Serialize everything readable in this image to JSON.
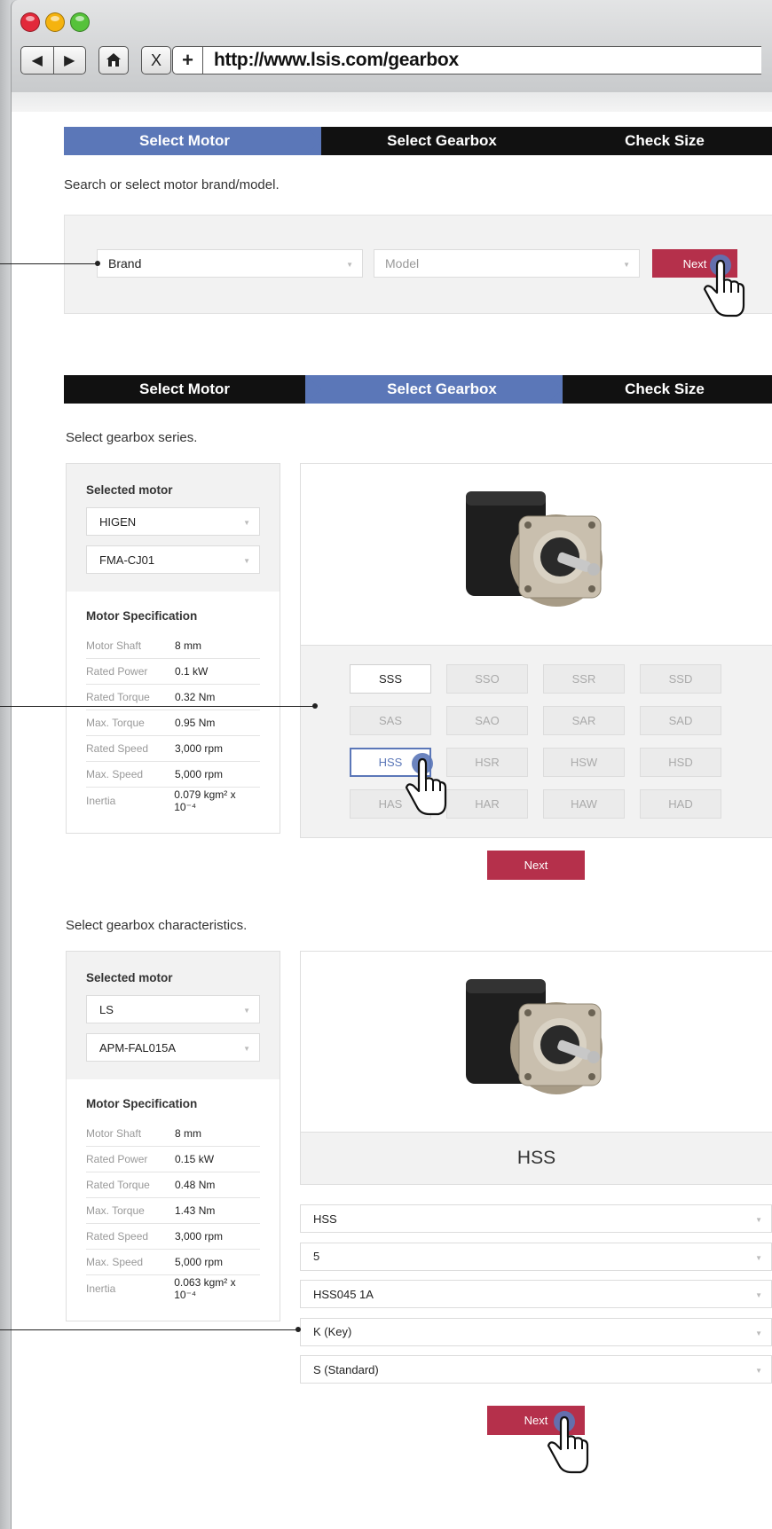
{
  "browser": {
    "url": "http://www.lsis.com/gearbox",
    "back_icon": "◀",
    "forward_icon": "▶",
    "close_label": "X",
    "new_tab_label": "+"
  },
  "steps": [
    "Select Motor",
    "Select Gearbox",
    "Check Size"
  ],
  "section1": {
    "hint": "Search or select motor brand/model.",
    "brand": "Brand",
    "model": "Model",
    "next": "Next"
  },
  "section2": {
    "hint": "Select gearbox series.",
    "selected_motor_label": "Selected motor",
    "brand": "HIGEN",
    "model": "FMA-CJ01",
    "spec_title": "Motor Specification",
    "specs": [
      {
        "k": "Motor Shaft",
        "v": "8 mm"
      },
      {
        "k": "Rated Power",
        "v": "0.1 kW"
      },
      {
        "k": "Rated Torque",
        "v": "0.32 Nm"
      },
      {
        "k": "Max. Torque",
        "v": "0.95 Nm"
      },
      {
        "k": "Rated Speed",
        "v": "3,000 rpm"
      },
      {
        "k": "Max. Speed",
        "v": "5,000 rpm"
      },
      {
        "k": "Inertia",
        "v": "0.079 kgm² x 10⁻⁴"
      }
    ],
    "series": [
      "SSS",
      "SSO",
      "SSR",
      "SSD",
      "SAS",
      "SAO",
      "SAR",
      "SAD",
      "HSS",
      "HSR",
      "HSW",
      "HSD",
      "HAS",
      "HAR",
      "HAW",
      "HAD"
    ],
    "next": "Next"
  },
  "section3": {
    "hint": "Select gearbox characteristics.",
    "selected_motor_label": "Selected motor",
    "brand": "LS",
    "model": "APM-FAL015A",
    "spec_title": "Motor Specification",
    "specs": [
      {
        "k": "Motor Shaft",
        "v": "8 mm"
      },
      {
        "k": "Rated Power",
        "v": "0.15 kW"
      },
      {
        "k": "Rated Torque",
        "v": "0.48 Nm"
      },
      {
        "k": "Max. Torque",
        "v": "1.43 Nm"
      },
      {
        "k": "Rated Speed",
        "v": "3,000 rpm"
      },
      {
        "k": "Max. Speed",
        "v": "5,000 rpm"
      },
      {
        "k": "Inertia",
        "v": "0.063 kgm² x 10⁻⁴"
      }
    ],
    "selected_series": "HSS",
    "options": [
      "HSS",
      "5",
      "HSS045 1A",
      "K (Key)",
      "S (Standard)"
    ],
    "next": "Next"
  },
  "colors": {
    "accent_blue": "#5b77b8",
    "next_red": "#b5304b",
    "step_black": "#111111"
  }
}
